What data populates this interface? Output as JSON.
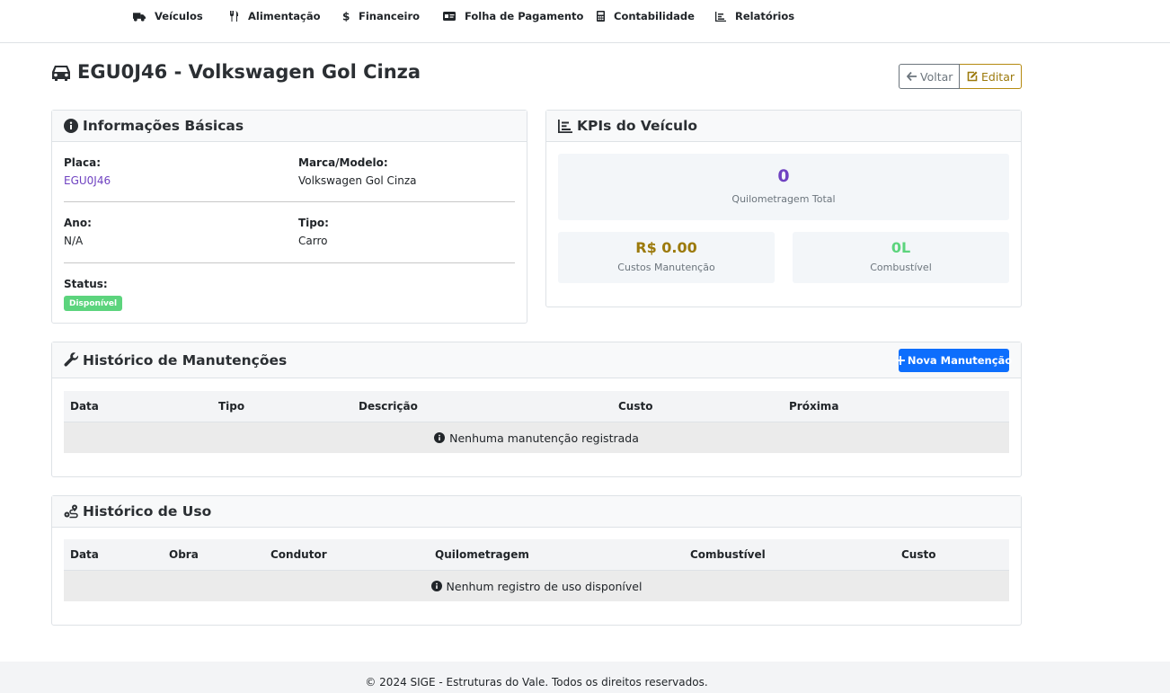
{
  "nav": {
    "items": [
      {
        "label": "Veículos",
        "icon": "truck-icon"
      },
      {
        "label": "Alimentação",
        "icon": "utensils-icon"
      },
      {
        "label": "Financeiro",
        "icon": "dollar-icon"
      },
      {
        "label": "Folha de Pagamento",
        "icon": "id-card-icon"
      },
      {
        "label": "Contabilidade",
        "icon": "calculator-icon"
      },
      {
        "label": "Relatórios",
        "icon": "chart-icon"
      }
    ]
  },
  "page": {
    "title": "EGU0J46 - Volkswagen Gol Cinza",
    "title_icon": "car-icon",
    "voltar_label": "Voltar",
    "editar_label": "Editar"
  },
  "info": {
    "header": "Informações Básicas",
    "placa_label": "Placa:",
    "placa_value": "EGU0J46",
    "marca_label": "Marca/Modelo:",
    "marca_value": "Volkswagen Gol Cinza",
    "ano_label": "Ano:",
    "ano_value": "N/A",
    "tipo_label": "Tipo:",
    "tipo_value": "Carro",
    "status_label": "Status:",
    "status_value": "Disponível"
  },
  "kpi": {
    "header": "KPIs do Veículo",
    "km_value": "0",
    "km_label": "Quilometragem Total",
    "custos_value": "R$ 0.00",
    "custos_label": "Custos Manutenção",
    "comb_value": "0L",
    "comb_label": "Combustível"
  },
  "manutencoes": {
    "header": "Histórico de Manutenções",
    "new_button": "Nova Manutenção",
    "columns": [
      "Data",
      "Tipo",
      "Descrição",
      "Custo",
      "Próxima"
    ],
    "empty": "Nenhuma manutenção registrada"
  },
  "uso": {
    "header": "Histórico de Uso",
    "columns": [
      "Data",
      "Obra",
      "Condutor",
      "Quilometragem",
      "Combustível",
      "Custo"
    ],
    "empty": "Nenhum registro de uso disponível"
  },
  "footer": {
    "text": "© 2024 SIGE - Estruturas do Vale. Todos os direitos reservados."
  },
  "colors": {
    "primary": "#0d6efd",
    "km_value": "#6f42c1",
    "custos_value": "#9c7a0c",
    "comb_value": "#5cd47d",
    "status_badge": "#5cd47d"
  }
}
